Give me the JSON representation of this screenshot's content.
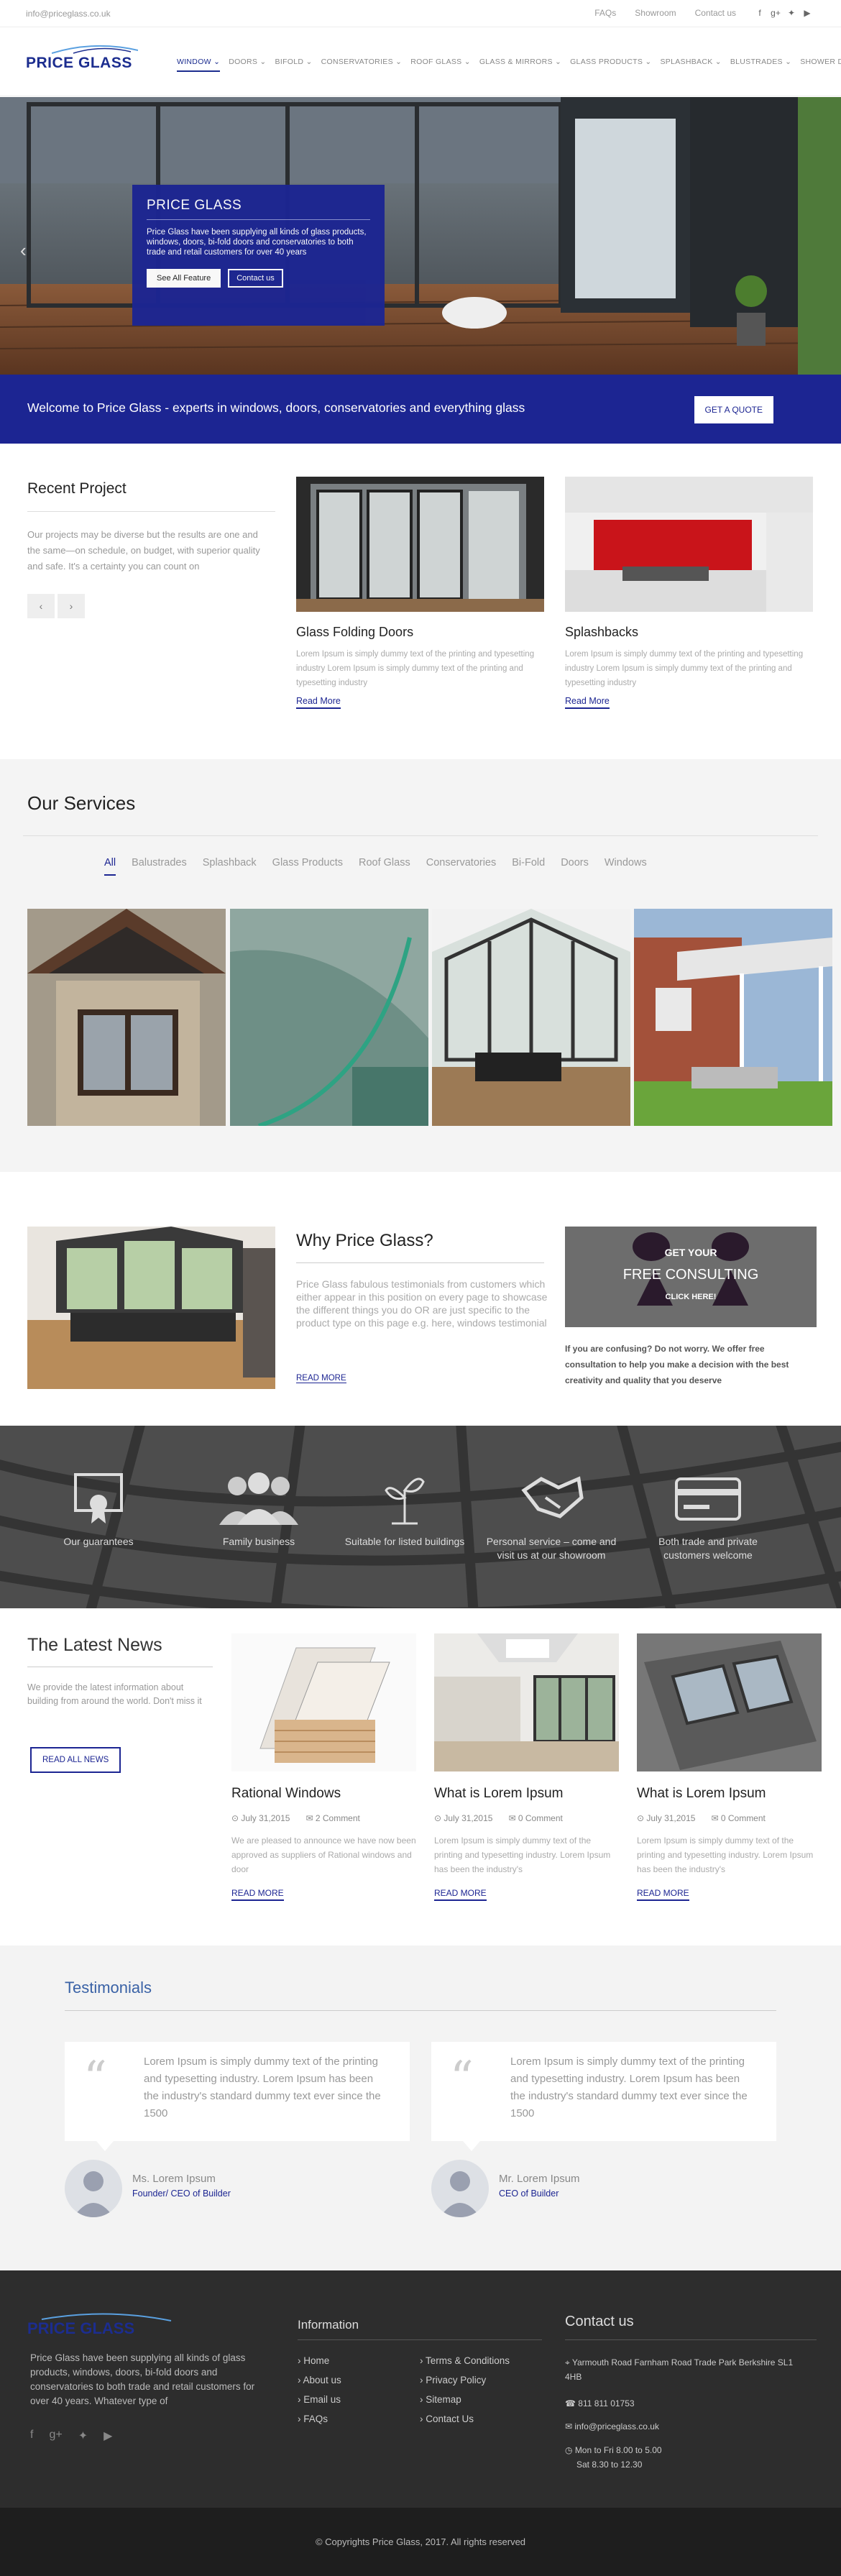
{
  "topbar": {
    "email": "info@priceglass.co.uk",
    "links": [
      "FAQs",
      "Showroom",
      "Contact us"
    ],
    "social_icons": [
      "facebook-icon",
      "google-plus-icon",
      "twitter-icon",
      "youtube-icon"
    ]
  },
  "logo": {
    "text": "PRICE GLASS"
  },
  "nav": [
    "WINDOW",
    "DOORS",
    "BIFOLD",
    "CONSERVATORIES",
    "ROOF GLASS",
    "GLASS & MIRRORS",
    "GLASS PRODUCTS",
    "SPLASHBACK",
    "BLUSTRADES",
    "SHOWER DOORS"
  ],
  "hero": {
    "title": "PRICE GLASS",
    "text": "Price Glass have been supplying all kinds of glass products, windows, doors, bi-fold doors and conservatories to both trade and retail customers for over 40 years",
    "btn1": "See All Feature",
    "btn2": "Contact us"
  },
  "band": {
    "text": "Welcome to Price Glass - experts in windows, doors, conservatories and everything glass",
    "button": "GET A QUOTE"
  },
  "recent": {
    "title": "Recent Project",
    "text": "Our projects may be diverse but the results are one and the same—on schedule, on budget, with superior quality and safe. It's a certainty you can count on",
    "cards": [
      {
        "title": "Glass Folding Doors",
        "text": "Lorem Ipsum is simply dummy text of the printing and typesetting industry Lorem Ipsum is simply dummy text of the printing and typesetting industry",
        "link": "Read More"
      },
      {
        "title": "Splashbacks",
        "text": "Lorem Ipsum is simply dummy text of the printing and typesetting industry Lorem Ipsum is simply dummy text of the printing and typesetting industry",
        "link": "Read More"
      }
    ]
  },
  "services": {
    "title": "Our Services",
    "filters": [
      "All",
      "Balustrades",
      "Splashback",
      "Glass Products",
      "Roof Glass",
      "Conservatories",
      "Bi-Fold",
      "Doors",
      "Windows"
    ]
  },
  "why": {
    "title": "Why Price Glass?",
    "text": "Price Glass fabulous testimonials from customers which either appear in this position on every page to showcase the different things you do OR are just specific to the product type on this page e.g. here, windows testimonial",
    "link": "READ MORE",
    "consult_small": "GET YOUR",
    "consult_big": "FREE CONSULTING",
    "consult_click": "CLICK HERE!",
    "consult_text": "If you are confusing? Do not worry. We offer free consultation to help you make a decision with the best creativity and quality that you deserve"
  },
  "features": [
    {
      "label": "Our guarantees",
      "icon": "certificate-icon"
    },
    {
      "label": "Family business",
      "icon": "people-icon"
    },
    {
      "label": "Suitable for listed buildings",
      "icon": "plant-icon"
    },
    {
      "label": "Personal service – come and visit us at our showroom",
      "icon": "handshake-icon"
    },
    {
      "label": "Both trade and private customers welcome",
      "icon": "card-icon"
    }
  ],
  "news": {
    "title": "The Latest News",
    "text": "We provide the latest information about building from around the world. Don't miss it",
    "button": "READ ALL NEWS",
    "cards": [
      {
        "title": "Rational Windows",
        "date": "July 31,2015",
        "comments": "2 Comment",
        "text": "We are pleased to announce we have now been approved as suppliers of Rational windows and door",
        "link": "READ MORE"
      },
      {
        "title": "What is Lorem Ipsum",
        "date": "July 31,2015",
        "comments": "0 Comment",
        "text": "Lorem Ipsum is simply dummy text of the printing and typesetting industry. Lorem Ipsum has been the industry's",
        "link": "READ MORE"
      },
      {
        "title": "What is Lorem Ipsum",
        "date": "July 31,2015",
        "comments": "0 Comment",
        "text": "Lorem Ipsum is simply dummy text of the printing and typesetting industry. Lorem Ipsum has been the industry's",
        "link": "READ MORE"
      }
    ]
  },
  "testimonials": {
    "title": "Testimonials",
    "items": [
      {
        "text": "Lorem Ipsum is simply dummy text of the printing and typesetting industry. Lorem Ipsum has been the industry's standard dummy text ever since the 1500",
        "name": "Ms. Lorem Ipsum",
        "role": "Founder/ CEO of Builder"
      },
      {
        "text": "Lorem Ipsum is simply dummy text of the printing and typesetting industry. Lorem Ipsum has been the industry's standard dummy text ever since the 1500",
        "name": "Mr. Lorem Ipsum",
        "role": "CEO of Builder"
      }
    ]
  },
  "footer": {
    "logo": "PRICE GLASS",
    "about": "Price Glass have been supplying all kinds of glass products, windows, doors, bi-fold doors and conservatories to both trade and retail customers for over 40 years. Whatever type of",
    "info_title": "Information",
    "info_col1": [
      "Home",
      "About us",
      "Email us",
      "FAQs"
    ],
    "info_col2": [
      "Terms & Conditions",
      "Privacy Policy",
      "Sitemap",
      "Contact Us"
    ],
    "contact_title": "Contact us",
    "address": "Yarmouth Road Farnham Road Trade Park Berkshire SL1 4HB",
    "phone": "811 811 01753",
    "email": "info@priceglass.co.uk",
    "hours1": "Mon to Fri 8.00 to 5.00",
    "hours2": "Sat 8.30 to 12.30",
    "copyright": "© Copyrights Price Glass, 2017. All rights reserved"
  }
}
